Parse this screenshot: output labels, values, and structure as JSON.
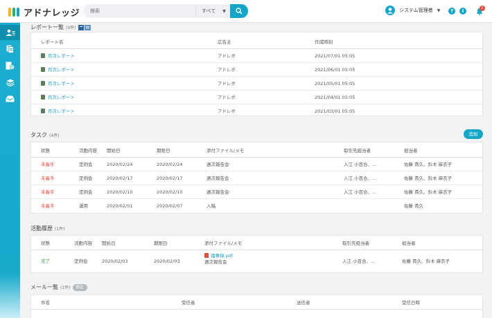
{
  "brand": {
    "name": "アドナレッジ",
    "accent": "#13a6c8"
  },
  "search": {
    "placeholder": "検索",
    "scope": "すべて"
  },
  "user": {
    "name": "システム管理者",
    "notification_count": "2"
  },
  "header_icons": {
    "help": "?",
    "info": "i"
  },
  "reports": {
    "title": "レポート一覧",
    "count": "(0件)",
    "columns": [
      "レポート名",
      "広告主",
      "作成時刻"
    ],
    "rows": [
      [
        "月次レポート",
        "アドレボ",
        "2021/07/01 05:05"
      ],
      [
        "月次レポート",
        "アドレボ",
        "2021/06/01 05:05"
      ],
      [
        "月次レポート",
        "アドレボ",
        "2021/05/01 05:05"
      ],
      [
        "月次レポート",
        "アドレボ",
        "2021/04/01 05:05"
      ],
      [
        "月次レポート",
        "アドレボ",
        "2021/03/01 05:05"
      ]
    ]
  },
  "tasks": {
    "title": "タスク",
    "count": "(4件)",
    "add_label": "追加",
    "columns": [
      "状態",
      "活動内容",
      "開始日",
      "期限日",
      "添付ファイル/メモ",
      "取引先担当者",
      "担当者"
    ],
    "rows": [
      [
        "未着手",
        "定例会",
        "2020/02/24",
        "2020/02/24",
        "週次報告会",
        "入江 小百合、...",
        "佐藤 貴久、鈴木 麻衣子"
      ],
      [
        "未着手",
        "定例会",
        "2020/02/17",
        "2020/02/17",
        "週次報告会",
        "入江 小百合、...",
        "佐藤 貴久、鈴木 麻衣子"
      ],
      [
        "未着手",
        "定例会",
        "2020/02/10",
        "2020/02/10",
        "週次報告会",
        "入江 小百合、...",
        "佐藤 貴久、鈴木 麻衣子"
      ],
      [
        "未着手",
        "運用",
        "2020/02/01",
        "2020/02/07",
        "入稿",
        "",
        "佐藤 貴久"
      ]
    ]
  },
  "activity": {
    "title": "活動履歴",
    "count": "(1件)",
    "columns": [
      "状態",
      "活動内容",
      "開始日",
      "期限日",
      "添付ファイル/メモ",
      "取引先担当者",
      "担当者"
    ],
    "rows": [
      [
        "完了",
        "定例会",
        "2020/02/03",
        "2020/02/03",
        "議事録.pdf",
        "週次報告会",
        "入江 小百合、...",
        "佐藤 貴久、鈴木 麻衣子"
      ]
    ]
  },
  "mail": {
    "title": "メール一覧",
    "count": "(1件)",
    "settings_label": "設定",
    "columns": [
      "件名",
      "受信者",
      "送信者",
      "受信日時"
    ]
  }
}
